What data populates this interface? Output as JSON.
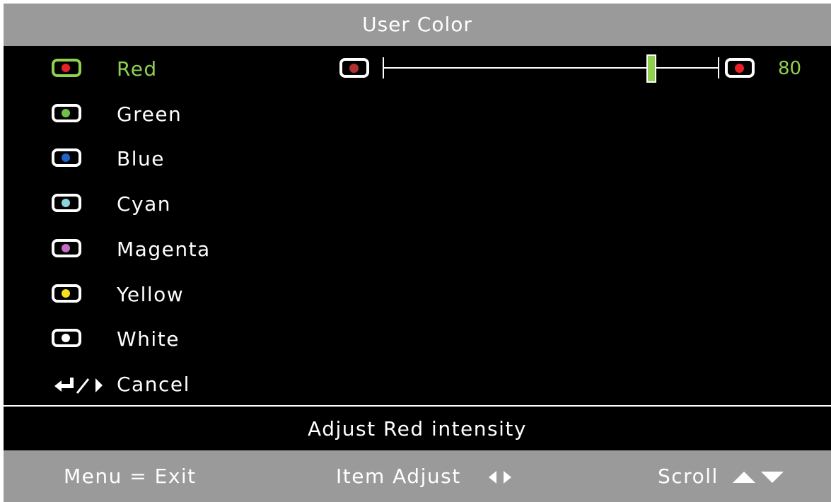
{
  "title": "User Color",
  "menu": {
    "items": [
      {
        "label": "Red",
        "dot_color": "#e8202a",
        "selected": true
      },
      {
        "label": "Green",
        "dot_color": "#6cc04a",
        "selected": false
      },
      {
        "label": "Blue",
        "dot_color": "#1e63c6",
        "selected": false
      },
      {
        "label": "Cyan",
        "dot_color": "#8ad4e0",
        "selected": false
      },
      {
        "label": "Magenta",
        "dot_color": "#c46cc4",
        "selected": false
      },
      {
        "label": "Yellow",
        "dot_color": "#f5e219",
        "selected": false
      },
      {
        "label": "White",
        "dot_color": "#ffffff",
        "selected": false
      }
    ],
    "cancel_label": "Cancel"
  },
  "slider": {
    "value": "80",
    "min_icon_dot_color": "#b03030",
    "max_icon_dot_color": "#e8202a",
    "level_fraction": 0.8
  },
  "help_text": "Adjust Red intensity",
  "footer": {
    "menu_hint": "Menu = Exit",
    "item_hint": "Item Adjust",
    "scroll_hint": "Scroll"
  },
  "colors": {
    "accent": "#8fd14f",
    "bar_gray": "#9a9a9a",
    "background": "#000000"
  }
}
